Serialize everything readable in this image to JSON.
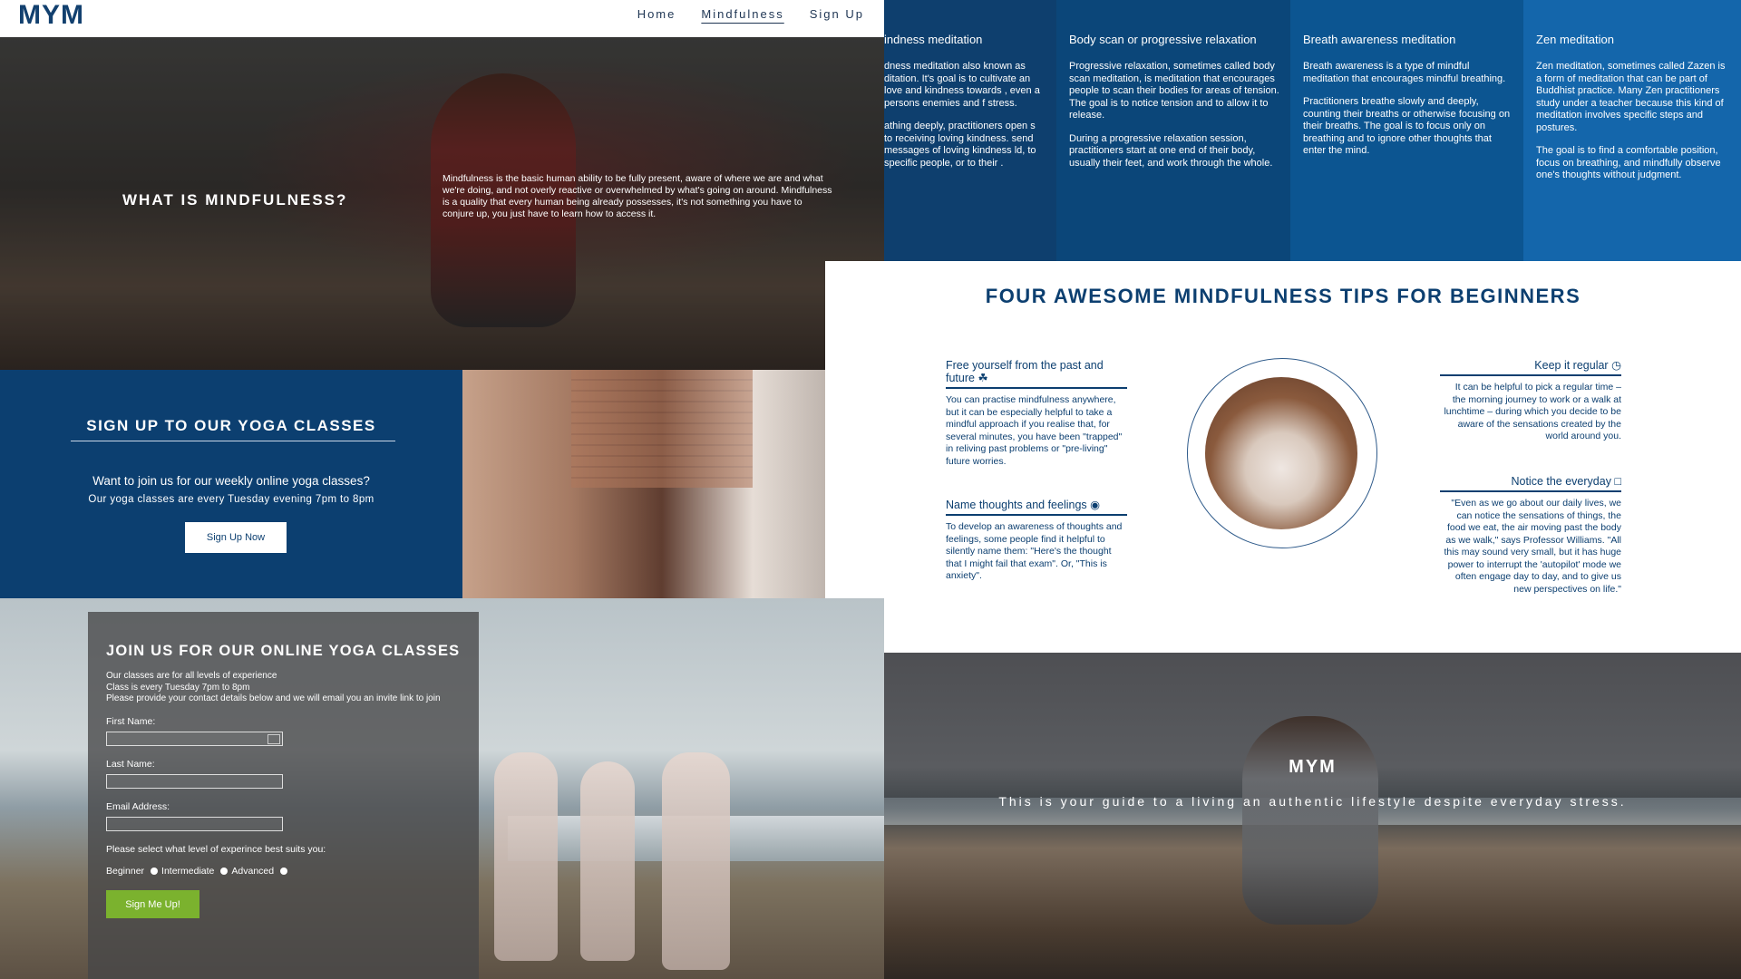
{
  "nav": {
    "logo": "MYM",
    "links": [
      "Home",
      "Mindfulness",
      "Sign Up"
    ]
  },
  "hero": {
    "title": "WHAT IS MINDFULNESS?",
    "text": "Mindfulness is the basic human ability to be fully present, aware of where we are and what we're doing, and not overly reactive or overwhelmed by what's going on around. Mindfulness is a quality that every human being already possesses, it's not something you have to conjure up, you just have to learn how to access it."
  },
  "types": [
    {
      "title": "indness meditation",
      "paras": [
        "dness meditation also known as ditation. It's goal is to cultivate an love and kindness towards , even a persons enemies and f stress.",
        "athing deeply, practitioners open s to receiving loving kindness. send messages of loving kindness ld, to specific people, or to their ."
      ]
    },
    {
      "title": "Body scan or progressive relaxation",
      "paras": [
        "Progressive relaxation, sometimes called body scan meditation, is meditation that encourages people to scan their bodies for areas of tension. The goal is to notice tension and to allow it to release.",
        "During a progressive relaxation session, practitioners start at one end of their body, usually their feet, and work through the whole."
      ]
    },
    {
      "title": "Breath awareness meditation",
      "paras": [
        "Breath awareness is a type of mindful meditation that encourages mindful breathing.",
        "Practitioners breathe slowly and deeply, counting their breaths or otherwise focusing on their breaths. The goal is to focus only on breathing and to ignore other thoughts that enter the mind."
      ]
    },
    {
      "title": "Zen meditation",
      "paras": [
        "Zen meditation, sometimes called Zazen is a form of meditation that can be part of Buddhist practice. Many Zen practitioners study under a teacher because this kind of meditation involves specific steps and postures.",
        "The goal is to find a comfortable position, focus on breathing, and mindfully observe one's thoughts without judgment."
      ]
    }
  ],
  "signup": {
    "title": "SIGN UP TO OUR YOGA CLASSES",
    "question": "Want to join us for our weekly online yoga classes?",
    "subtitle": "Our yoga classes are every Tuesday evening 7pm to 8pm",
    "button": "Sign Up Now"
  },
  "tips": {
    "title": "FOUR AWESOME MINDFULNESS TIPS FOR BEGINNERS",
    "items": [
      {
        "title": "Free yourself from the past and future",
        "text": "You can practise mindfulness anywhere, but it can be especially helpful to take a mindful approach if you realise that, for several minutes, you have been \"trapped\" in reliving past problems or \"pre-living\" future worries."
      },
      {
        "title": "Name thoughts and feelings",
        "text": "To develop an awareness of thoughts and feelings, some people find it helpful to silently name them: \"Here's the thought that I might fail that exam\". Or, \"This is anxiety\"."
      },
      {
        "title": "Keep it regular",
        "text": "It can be helpful to pick a regular time – the morning journey to work or a walk at lunchtime – during which you decide to be aware of the sensations created by the world around you."
      },
      {
        "title": "Notice the everyday",
        "text": "\"Even as we go about our daily lives, we can notice the sensations of things, the food we eat, the air moving past the body as we walk,\" says Professor Williams. \"All this may sound very small, but it has huge power to interrupt the 'autopilot' mode we often engage day to day, and to give us new perspectives on life.\""
      }
    ]
  },
  "join": {
    "title": "JOIN US FOR OUR ONLINE YOGA CLASSES",
    "info": [
      "Our classes are for all levels of experience",
      "Class is every Tuesday 7pm to 8pm",
      "Please provide your contact details below and we will email you an invite link to join"
    ],
    "first_name_label": "First Name:",
    "last_name_label": "Last Name:",
    "email_label": "Email Address:",
    "level_prompt": "Please select what level of experince best suits you:",
    "levels": [
      "Beginner",
      "Intermediate",
      "Advanced"
    ],
    "submit": "Sign Me Up!"
  },
  "footer_hero": {
    "title": "MYM",
    "subtitle": "This is your guide to a living an authentic lifestyle despite everyday stress."
  }
}
